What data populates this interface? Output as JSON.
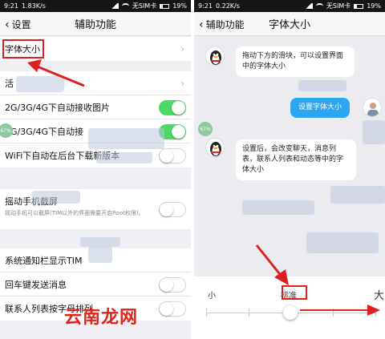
{
  "left_screen": {
    "status": {
      "time": "9:21",
      "speed": "1.83K/s",
      "carrier": "无SIM卡",
      "battery": "19%"
    },
    "nav": {
      "back_label": "设置",
      "title": "辅助功能"
    },
    "rows": [
      {
        "label": "字体大小"
      },
      {
        "label": "活"
      },
      {
        "label": "2G/3G/4G下自动接收图片",
        "toggle": true
      },
      {
        "label": "2G/3G/4G下自动接",
        "toggle": true
      },
      {
        "label": "WiFi下自动在后台下载新版本",
        "toggle": false
      },
      {
        "label": "摇动手机截屏",
        "sub": "摇动手机可以截屏(TIM以外的界面需要开启Root权限)。",
        "toggle": false
      },
      {
        "label": "系统通知栏显示TIM"
      },
      {
        "label": "回车键发送消息",
        "toggle": false
      },
      {
        "label": "联系人列表按字母排列",
        "toggle": false
      }
    ],
    "badge": "67%"
  },
  "right_screen": {
    "status": {
      "time": "9:21",
      "speed": "0.22K/s",
      "carrier": "无SIM卡",
      "battery": "19%"
    },
    "nav": {
      "back_label": "辅助功能",
      "title": "字体大小"
    },
    "messages": {
      "m1": "拖动下方的滑块，可以设置界面中的字体大小",
      "m2": "设置字体大小",
      "m3": "设置后，会改变聊天，消息列表，联系人列表和动态等中的字体大小"
    },
    "badge": "67%",
    "slider": {
      "small_label": "小",
      "standard_label": "标准",
      "large_label": "大",
      "level_index": 2,
      "level_count": 5
    }
  },
  "watermark": "云南龙网",
  "colors": {
    "toggle_on": "#4cd964",
    "bubble_out": "#2da6f1",
    "annotation": "#e02020"
  },
  "icons": [
    "back-chevron-icon",
    "qq-penguin-icon",
    "user-avatar-icon",
    "row-arrow-icon"
  ]
}
